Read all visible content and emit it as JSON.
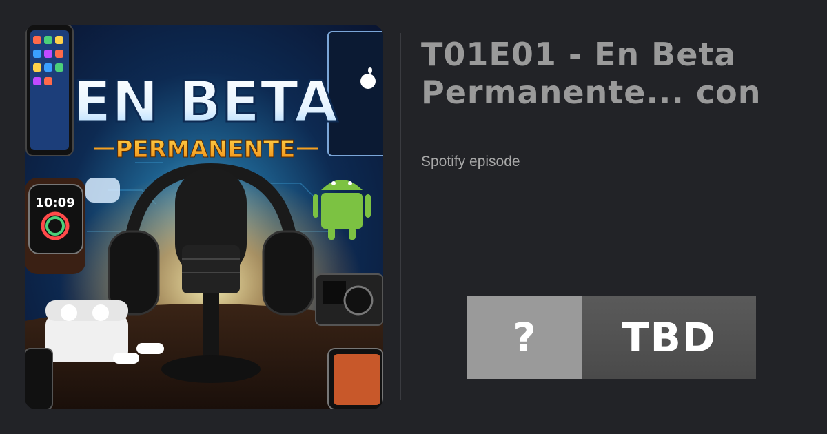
{
  "episode": {
    "title": "T01E01 - En Beta\nPermanente... con",
    "source": "Spotify episode"
  },
  "cover": {
    "headline": "EN BETA",
    "tagline": "PERMANENTE",
    "watch_time": "10:09"
  },
  "badge": {
    "symbol": "?",
    "label": "TBD"
  },
  "colors": {
    "page_background": "#222327",
    "title_text": "#9a9a9a",
    "badge_left": "#9a9a9a",
    "badge_right": "#4f4f4f",
    "tagline": "#f5a020"
  },
  "icons": [
    "microphone-icon",
    "headphones-icon",
    "smartwatch-icon",
    "earbuds-icon",
    "android-icon",
    "apple-logo-icon",
    "camera-icon",
    "phone-icon"
  ]
}
